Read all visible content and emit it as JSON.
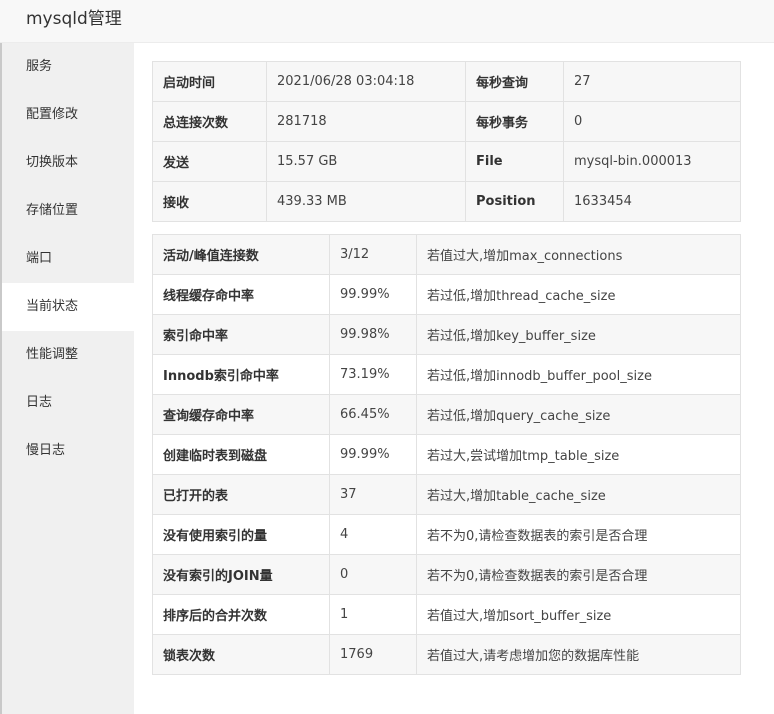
{
  "window": {
    "title": "mysqld管理"
  },
  "sidebar": {
    "items": [
      {
        "label": "服务"
      },
      {
        "label": "配置修改"
      },
      {
        "label": "切换版本"
      },
      {
        "label": "存储位置"
      },
      {
        "label": "端口"
      },
      {
        "label": "当前状态",
        "active": true
      },
      {
        "label": "性能调整"
      },
      {
        "label": "日志"
      },
      {
        "label": "慢日志"
      }
    ]
  },
  "info": {
    "rows": [
      {
        "k1": "启动时间",
        "v1": "2021/06/28 03:04:18",
        "k2": "每秒查询",
        "v2": "27"
      },
      {
        "k1": "总连接次数",
        "v1": "281718",
        "k2": "每秒事务",
        "v2": "0"
      },
      {
        "k1": "发送",
        "v1": "15.57 GB",
        "k2": "File",
        "v2": "mysql-bin.000013"
      },
      {
        "k1": "接收",
        "v1": "439.33 MB",
        "k2": "Position",
        "v2": "1633454"
      }
    ]
  },
  "stats": {
    "rows": [
      {
        "name": "活动/峰值连接数",
        "value": "3/12",
        "hint": "若值过大,增加max_connections"
      },
      {
        "name": "线程缓存命中率",
        "value": "99.99%",
        "hint": "若过低,增加thread_cache_size"
      },
      {
        "name": "索引命中率",
        "value": "99.98%",
        "hint": "若过低,增加key_buffer_size"
      },
      {
        "name": "Innodb索引命中率",
        "value": "73.19%",
        "hint": "若过低,增加innodb_buffer_pool_size"
      },
      {
        "name": "查询缓存命中率",
        "value": "66.45%",
        "hint": "若过低,增加query_cache_size"
      },
      {
        "name": "创建临时表到磁盘",
        "value": "99.99%",
        "hint": "若过大,尝试增加tmp_table_size"
      },
      {
        "name": "已打开的表",
        "value": "37",
        "hint": "若过大,增加table_cache_size"
      },
      {
        "name": "没有使用索引的量",
        "value": "4",
        "hint": "若不为0,请检查数据表的索引是否合理"
      },
      {
        "name": "没有索引的JOIN量",
        "value": "0",
        "hint": "若不为0,请检查数据表的索引是否合理"
      },
      {
        "name": "排序后的合并次数",
        "value": "1",
        "hint": "若值过大,增加sort_buffer_size"
      },
      {
        "name": "锁表次数",
        "value": "1769",
        "hint": "若值过大,请考虑增加您的数据库性能"
      }
    ]
  }
}
